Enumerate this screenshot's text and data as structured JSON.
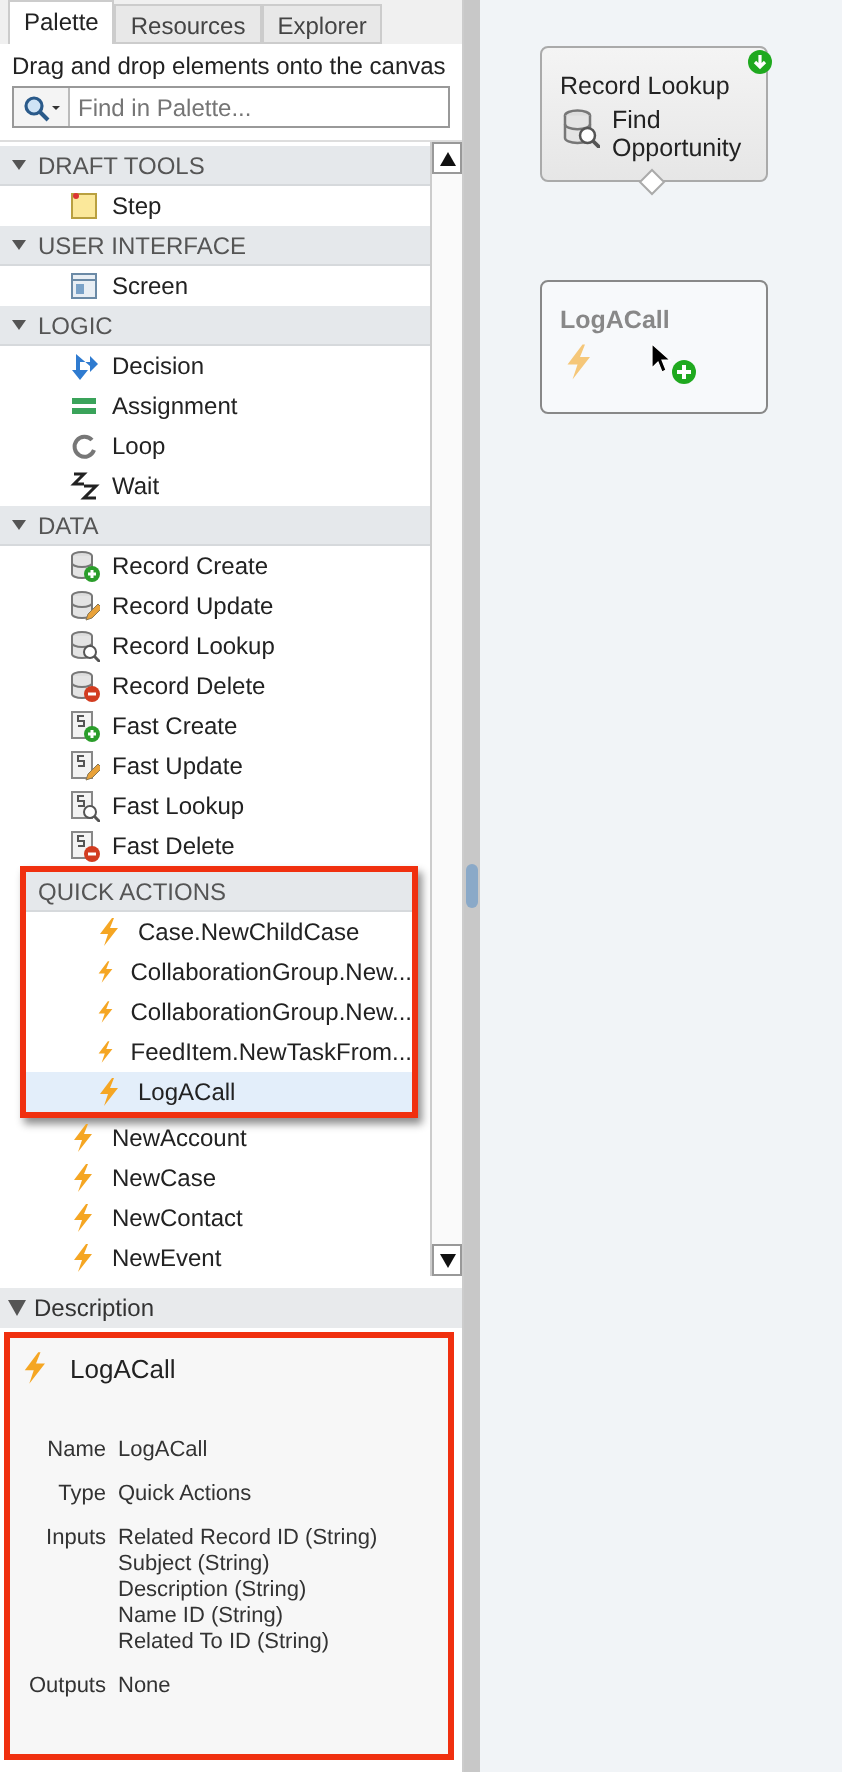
{
  "tabs": [
    {
      "label": "Palette",
      "selected": true
    },
    {
      "label": "Resources",
      "selected": false
    },
    {
      "label": "Explorer",
      "selected": false
    }
  ],
  "instruction": "Drag and drop elements onto the canvas",
  "search": {
    "placeholder": "Find in Palette..."
  },
  "sections": [
    {
      "title": "DRAFT TOOLS",
      "expanded": true,
      "items": [
        {
          "label": "Step",
          "kind": "step",
          "selected": false
        }
      ]
    },
    {
      "title": "USER INTERFACE",
      "expanded": true,
      "items": [
        {
          "label": "Screen",
          "kind": "screen",
          "selected": false
        }
      ]
    },
    {
      "title": "LOGIC",
      "expanded": true,
      "items": [
        {
          "label": "Decision",
          "kind": "decision",
          "selected": false
        },
        {
          "label": "Assignment",
          "kind": "assignment",
          "selected": false
        },
        {
          "label": "Loop",
          "kind": "loop",
          "selected": false
        },
        {
          "label": "Wait",
          "kind": "wait",
          "selected": false
        }
      ]
    },
    {
      "title": "DATA",
      "expanded": true,
      "items": [
        {
          "label": "Record Create",
          "kind": "db-create",
          "selected": false
        },
        {
          "label": "Record Update",
          "kind": "db-update",
          "selected": false
        },
        {
          "label": "Record Lookup",
          "kind": "db-lookup",
          "selected": false
        },
        {
          "label": "Record Delete",
          "kind": "db-delete",
          "selected": false
        },
        {
          "label": "Fast Create",
          "kind": "s-create",
          "selected": false
        },
        {
          "label": "Fast Update",
          "kind": "s-update",
          "selected": false
        },
        {
          "label": "Fast Lookup",
          "kind": "s-lookup",
          "selected": false
        },
        {
          "label": "Fast Delete",
          "kind": "s-delete",
          "selected": false
        }
      ]
    },
    {
      "title": "QUICK ACTIONS",
      "highlighted": true,
      "items": [
        {
          "label": "Case.NewChildCase",
          "kind": "bolt",
          "selected": false,
          "highlighted": true
        },
        {
          "label": "CollaborationGroup.New...",
          "kind": "bolt",
          "selected": false,
          "highlighted": true
        },
        {
          "label": "CollaborationGroup.New...",
          "kind": "bolt",
          "selected": false,
          "highlighted": true
        },
        {
          "label": "FeedItem.NewTaskFrom...",
          "kind": "bolt",
          "selected": false,
          "highlighted": true
        },
        {
          "label": "LogACall",
          "kind": "bolt",
          "selected": true,
          "highlighted": true
        },
        {
          "label": "NewAccount",
          "kind": "bolt",
          "selected": false,
          "highlighted": false
        },
        {
          "label": "NewCase",
          "kind": "bolt",
          "selected": false,
          "highlighted": false
        },
        {
          "label": "NewContact",
          "kind": "bolt",
          "selected": false,
          "highlighted": false
        },
        {
          "label": "NewEvent",
          "kind": "bolt",
          "selected": false,
          "highlighted": false
        }
      ]
    }
  ],
  "description": {
    "header": "Description",
    "expanded": true,
    "highlighted": true,
    "title": "LogACall",
    "fields": [
      {
        "label": "Name",
        "values": [
          "LogACall"
        ]
      },
      {
        "label": "Type",
        "values": [
          "Quick Actions"
        ]
      },
      {
        "label": "Inputs",
        "values": [
          "Related Record ID (String)",
          "Subject (String)",
          "Description (String)",
          "Name ID (String)",
          "Related To ID (String)"
        ]
      },
      {
        "label": "Outputs",
        "values": [
          "None"
        ]
      }
    ]
  },
  "canvas": {
    "nodes": [
      {
        "kind": "lookup",
        "title": "Record Lookup",
        "label": "Find Opportunity",
        "start": true,
        "dragging": false
      },
      {
        "kind": "quick-action",
        "title": "LogACall",
        "start": false,
        "dragging": true
      }
    ]
  }
}
